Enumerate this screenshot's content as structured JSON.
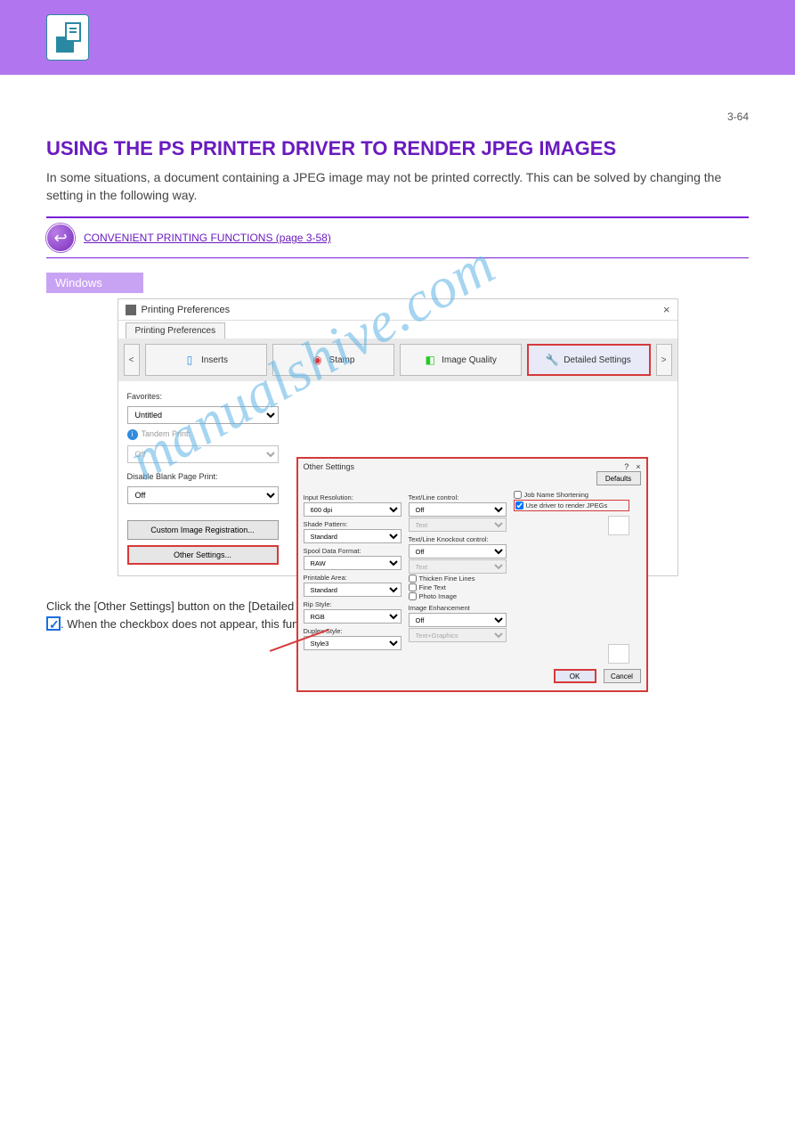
{
  "page_number": "3-64",
  "heading": "USING THE PS PRINTER DRIVER TO RENDER JPEG IMAGES",
  "subheading": "In some situations, a document containing a JPEG image may not be printed correctly. This can be solved by changing the setting in the following way.",
  "back_link": "CONVENIENT PRINTING FUNCTIONS (page 3-58)",
  "windows_label": "Windows",
  "window": {
    "title": "Printing Preferences",
    "tab_active": "Printing Preferences",
    "tabs": {
      "inserts": "Inserts",
      "stamp": "Stamp",
      "image_quality": "Image Quality",
      "detailed": "Detailed Settings"
    },
    "nav_left": "<",
    "nav_right": ">",
    "close_x": "×",
    "left": {
      "favorites_label": "Favorites:",
      "favorites_value": "Untitled",
      "tandem_label": "Tandem Print:",
      "tandem_value": "Off",
      "disable_blank_label": "Disable Blank Page Print:",
      "disable_blank_value": "Off",
      "custom_img_btn": "Custom Image Registration...",
      "other_settings_btn": "Other Settings..."
    },
    "modal": {
      "title": "Other Settings",
      "q": "?",
      "x": "×",
      "defaults_btn": "Defaults",
      "col_a": {
        "input_res_label": "Input Resolution:",
        "input_res_value": "600 dpi",
        "shade_label": "Shade Pattern:",
        "shade_value": "Standard",
        "spool_label": "Spool Data Format:",
        "spool_value": "RAW",
        "printable_label": "Printable Area:",
        "printable_value": "Standard",
        "rip_label": "Rip Style:",
        "rip_value": "RGB",
        "duplex_label": "Duplex Style:",
        "duplex_value": "Style3"
      },
      "col_b": {
        "tl_ctrl_label": "Text/Line control:",
        "tl_ctrl_value": "Off",
        "tl_hint": "Text",
        "tlko_label": "Text/Line Knockout control:",
        "tlko_value": "Off",
        "tlko_hint": "Text",
        "thicken_label": "Thicken Fine Lines",
        "fine_text_label": "Fine Text",
        "photo_label": "Photo Image",
        "img_enh_label": "Image Enhancement",
        "img_enh_value": "Off",
        "tg_hint": "Text+Graphics"
      },
      "col_c": {
        "job_short_label": "Job Name Shortening",
        "jpeg_label": "Use driver to render JPEGs"
      },
      "ok_btn": "OK",
      "cancel_btn": "Cancel"
    }
  },
  "instruction_before": "Click the [Other Settings] button on the [Detailed Settings] tab and set the [Use driver to render JPEGs] checkbox to",
  "instruction_after": ". When the checkbox does not appear, this function is not available.",
  "watermark": "manualshive.com"
}
